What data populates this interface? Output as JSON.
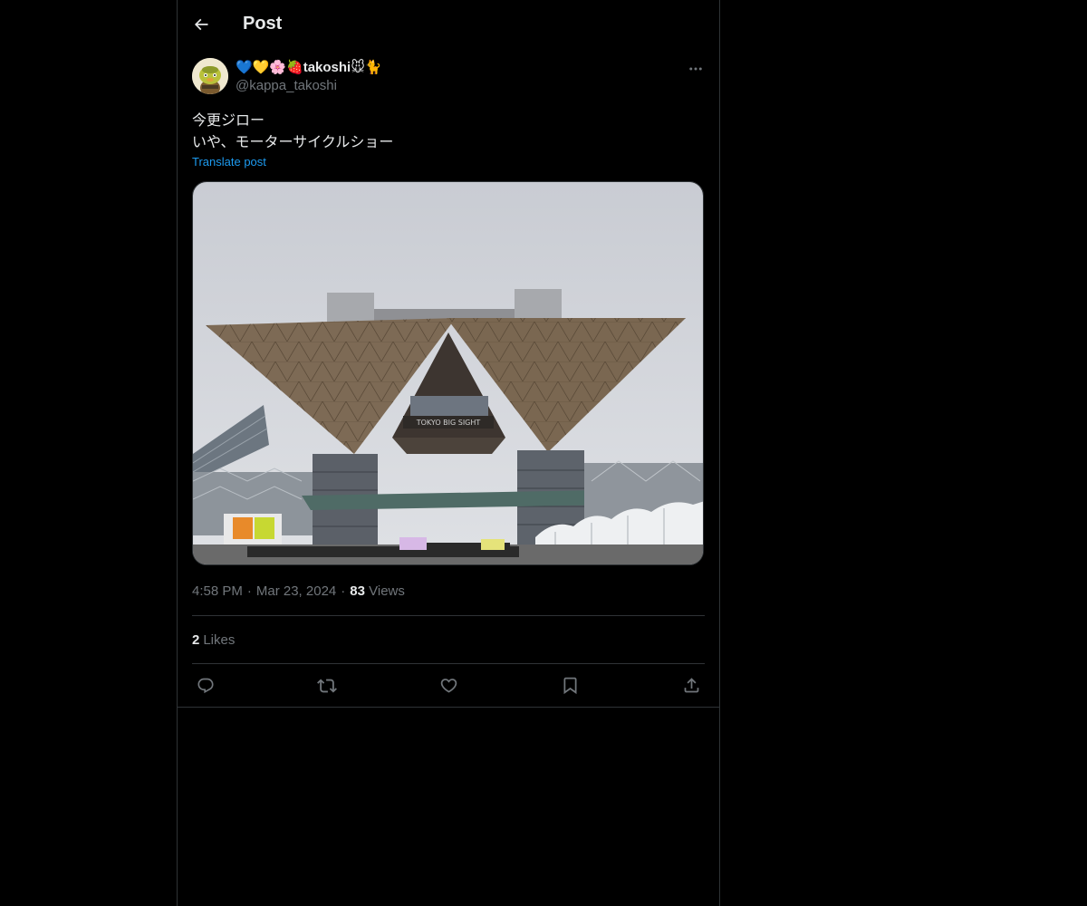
{
  "header": {
    "title": "Post",
    "back_icon": "arrow-left-icon"
  },
  "post": {
    "author": {
      "display_name": "💙💛🌸🍓takoshi🐭🐈",
      "handle": "@kappa_takoshi",
      "avatar": "avatar-image"
    },
    "text": "今更ジロー\nいや、モーターサイクルショー",
    "translate_label": "Translate post",
    "media": {
      "image_subject": "photo",
      "sign_text": "TOKYO BIG SIGHT"
    },
    "time": "4:58 PM",
    "date": "Mar 23, 2024",
    "views_count": "83",
    "views_label": "Views",
    "likes_count": "2",
    "likes_label": "Likes",
    "actions": [
      {
        "name": "reply",
        "icon": "reply-icon"
      },
      {
        "name": "repost",
        "icon": "repost-icon"
      },
      {
        "name": "like",
        "icon": "heart-icon"
      },
      {
        "name": "bookmark",
        "icon": "bookmark-icon"
      },
      {
        "name": "share",
        "icon": "share-icon"
      }
    ]
  },
  "colors": {
    "background": "#000000",
    "text": "#e7e9ea",
    "secondary_text": "#71767b",
    "accent": "#1d9bf0",
    "border": "#2f3336"
  }
}
